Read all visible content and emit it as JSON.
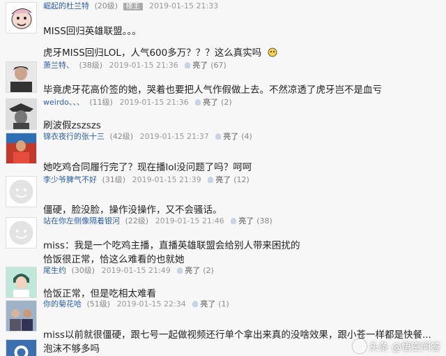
{
  "posts": [
    {
      "user": "崛起的杜兰特",
      "level": "(20级)",
      "tag": "楼主",
      "time": "2019-01-15 21:33",
      "lines": [
        "MISS回归英雄联盟。。。",
        "虎牙MISS回归LOL，人气600多万？？？这么真实吗"
      ],
      "avatar_icon": "cartoon-face-icon"
    },
    {
      "user": "萧兰特、",
      "level": "(38级)",
      "time": "2019-01-15 21:36",
      "like_label": "亮了",
      "like_count": "(67)",
      "lines": [
        "毕竟虎牙花高价签的她，哭着也要把人气作假做上去。不然凉透了虎牙岂不是血亏"
      ],
      "avatar_icon": "person-photo-icon"
    },
    {
      "user": "weirdo、、、",
      "level": "(11级)",
      "time": "2019-01-15 21:36",
      "like_label": "亮了",
      "like_count": "(2)",
      "lines": [
        "刷波假zszszs"
      ],
      "avatar_icon": "dark-character-icon"
    },
    {
      "user": "锦衣夜行的张十三",
      "level": "(42级)",
      "time": "2019-01-15 21:37",
      "like_label": "亮了",
      "like_count": "(4)",
      "lines": [
        "她吃鸡合同履行完了？现在播lol没问题了吗？呵呵"
      ],
      "avatar_icon": "player-photo-icon"
    },
    {
      "user": "李少爷脾气不好",
      "level": "(31级)",
      "time": "2019-01-15 21:39",
      "like_label": "亮了",
      "like_count": "(12)",
      "lines": [
        "僵硬，脸没脸，操作没操作，又不会骚话。"
      ],
      "avatar_icon": "default-face-icon"
    },
    {
      "user": "站在你左侧像隔着银河",
      "level": "(22级)",
      "time": "2019-01-15 21:46",
      "like_label": "亮了",
      "like_count": "(38)",
      "lines": [
        "miss：我是一个吃鸡主播，直播英雄联盟会给别人带来困扰的",
        "恰饭很正常，恰这么难看的也就她"
      ],
      "avatar_icon": "default-face-icon"
    },
    {
      "user": "尾生约",
      "level": "(30级)",
      "time": "2019-01-15 21:49",
      "like_label": "亮了",
      "like_count": "(2)",
      "lines": [
        "恰饭正常，但是吃相太难看"
      ],
      "avatar_icon": "anime-avatar-icon"
    },
    {
      "user": "你的菊花哈",
      "level": "(51级)",
      "time": "2019-01-15 22:34",
      "like_label": "亮了",
      "like_count": "(1)",
      "lines": [
        "miss以前就很僵硬，跟七号一起做视频还行单个拿出来真的没啥效果，跟小苍一样都是快餐...",
        "泡沫不够多吗"
      ],
      "avatar_icon": "group-photo-icon"
    }
  ],
  "watermark": "头条 @悟空问答",
  "colors": {
    "username": "#2b5fa8",
    "meta": "#888888",
    "background": "#f7f7f7"
  }
}
